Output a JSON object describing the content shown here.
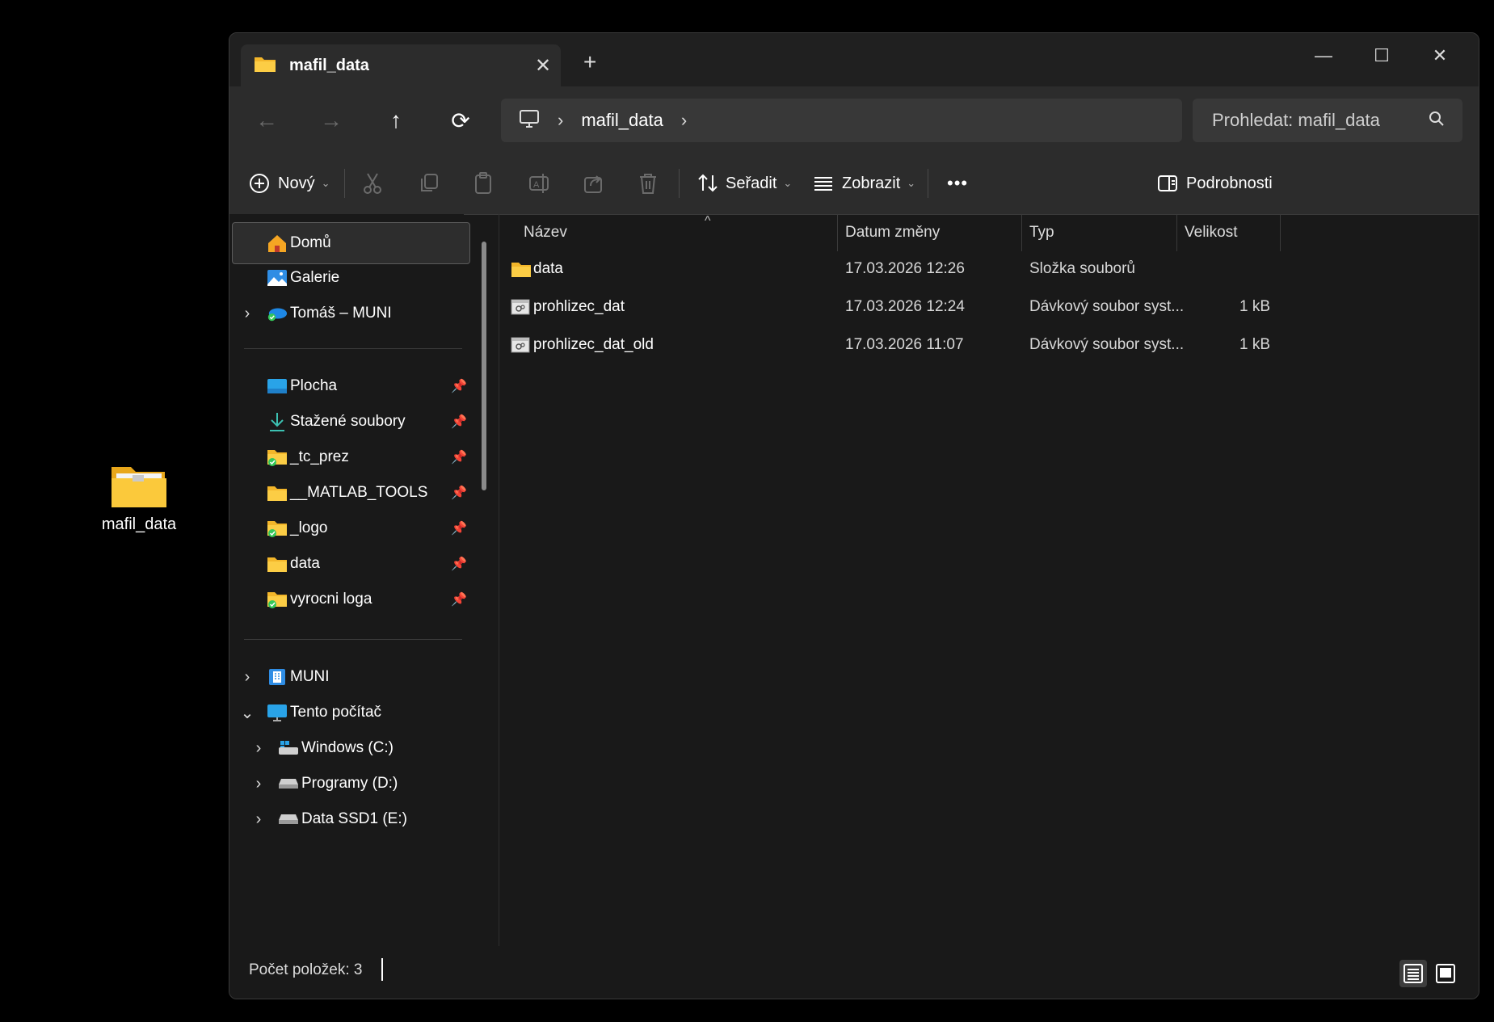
{
  "desktop": {
    "icon_label": "mafil_data"
  },
  "window": {
    "tab_title": "mafil_data",
    "new_tab": "+",
    "controls": {
      "minimize": "—",
      "maximize": "☐",
      "close": "✕"
    }
  },
  "navbar": {
    "back": "←",
    "forward": "→",
    "up": "↑",
    "refresh": "⟳",
    "breadcrumb": [
      "mafil_data"
    ],
    "search_placeholder": "Prohledat: mafil_data"
  },
  "commandbar": {
    "new_label": "Nový",
    "sort_label": "Seřadit",
    "view_label": "Zobrazit",
    "more_label": "•••",
    "details_label": "Podrobnosti"
  },
  "sidebar": {
    "top": [
      {
        "label": "Domů",
        "icon": "home-icon",
        "selected": true,
        "expand": ""
      },
      {
        "label": "Galerie",
        "icon": "gallery-icon",
        "selected": false,
        "expand": ""
      },
      {
        "label": "Tomáš – MUNI",
        "icon": "onedrive-icon",
        "selected": false,
        "expand": "›"
      }
    ],
    "pinned": [
      {
        "label": "Plocha",
        "icon": "desktop-folder-icon"
      },
      {
        "label": "Stažené soubory",
        "icon": "download-icon"
      },
      {
        "label": "_tc_prez",
        "icon": "synced-folder-icon"
      },
      {
        "label": "__MATLAB_TOOLS",
        "icon": "folder-icon"
      },
      {
        "label": "_logo",
        "icon": "synced-folder-icon"
      },
      {
        "label": "data",
        "icon": "folder-icon"
      },
      {
        "label": "vyrocni loga",
        "icon": "synced-folder-icon"
      }
    ],
    "drives": [
      {
        "label": "MUNI",
        "icon": "building-icon",
        "expand": "›",
        "indent": 0
      },
      {
        "label": "Tento počítač",
        "icon": "computer-icon",
        "expand": "⌄",
        "indent": 0
      },
      {
        "label": "Windows (C:)",
        "icon": "windows-drive-icon",
        "expand": "›",
        "indent": 1
      },
      {
        "label": "Programy (D:)",
        "icon": "drive-icon",
        "expand": "›",
        "indent": 1
      },
      {
        "label": "Data SSD1 (E:)",
        "icon": "drive-icon",
        "expand": "›",
        "indent": 1
      }
    ],
    "pin_glyph": "📌"
  },
  "columns": [
    "Název",
    "Datum změny",
    "Typ",
    "Velikost"
  ],
  "files": [
    {
      "name": "data",
      "date": "17.03.2026 12:26",
      "type": "Složka souborů",
      "size": "",
      "icon": "folder-icon"
    },
    {
      "name": "prohlizec_dat",
      "date": "17.03.2026 12:24",
      "type": "Dávkový soubor syst...",
      "size": "1 kB",
      "icon": "batch-file-icon"
    },
    {
      "name": "prohlizec_dat_old",
      "date": "17.03.2026 11:07",
      "type": "Dávkový soubor syst...",
      "size": "1 kB",
      "icon": "batch-file-icon"
    }
  ],
  "status": {
    "item_count": "Počet položek: 3"
  }
}
